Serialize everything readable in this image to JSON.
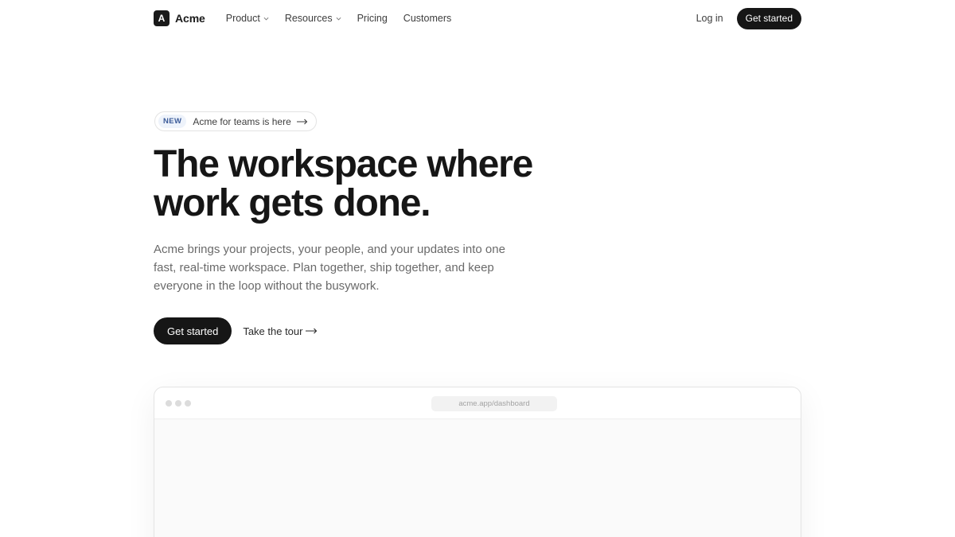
{
  "nav": {
    "brand_mark": "A",
    "brand_name": "Acme",
    "links": [
      {
        "label": "Product",
        "has_dropdown": true
      },
      {
        "label": "Resources",
        "has_dropdown": true
      },
      {
        "label": "Pricing",
        "has_dropdown": false
      },
      {
        "label": "Customers",
        "has_dropdown": false
      }
    ],
    "login_label": "Log in",
    "cta_label": "Get started"
  },
  "hero": {
    "badge": "NEW",
    "announcement": "Acme for teams is here",
    "title_line1": "The workspace where",
    "title_line2": "work gets done.",
    "subtitle": "Acme brings your projects, your people, and your updates into one fast, real-time workspace. Plan together, ship together, and keep everyone in the loop without the busywork.",
    "primary_cta": "Get started",
    "secondary_cta": "Take the tour"
  },
  "preview": {
    "url": "acme.app/dashboard"
  },
  "icons": {
    "dropdown": "chevron-down-icon",
    "arrow": "arrow-right-icon"
  },
  "colors": {
    "primary": "#161616",
    "badge_bg": "#eef3fb",
    "badge_text": "#3b5b99",
    "muted_text": "#6a6a6a"
  }
}
